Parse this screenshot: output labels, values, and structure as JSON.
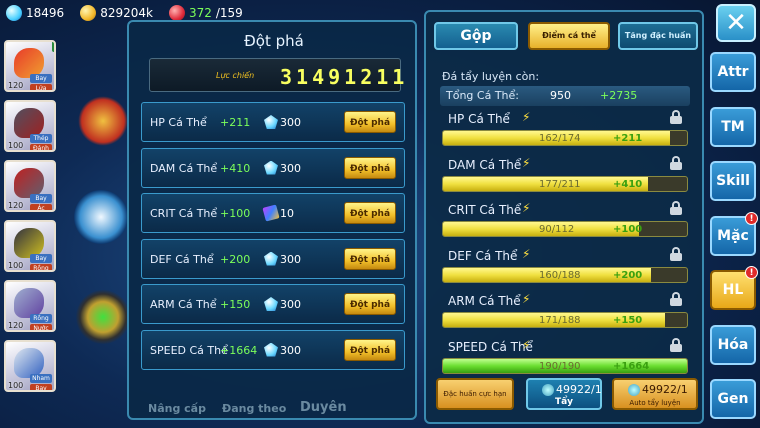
{
  "topbar": {
    "gems": "18496",
    "gold": "829204k",
    "stamina_current": "372",
    "stamina_max": "/159"
  },
  "pets": [
    {
      "level": "120",
      "tag1": "Bay",
      "tag2": "Lửa",
      "count": "1",
      "c1": "#e83a2a",
      "c2": "#f0a030"
    },
    {
      "level": "100",
      "tag1": "Thép",
      "tag2": "Đánh",
      "count": "",
      "c1": "#505060",
      "c2": "#a02020"
    },
    {
      "level": "120",
      "tag1": "Bay",
      "tag2": "Ác",
      "count": "",
      "c1": "#c02020",
      "c2": "#606070"
    },
    {
      "level": "100",
      "tag1": "Bay",
      "tag2": "Rồng",
      "count": "",
      "c1": "#303040",
      "c2": "#d0c020"
    },
    {
      "level": "120",
      "tag1": "Rồng",
      "tag2": "Nước",
      "count": "",
      "c1": "#a0b0d0",
      "c2": "#6040a0"
    },
    {
      "level": "100",
      "tag1": "Nham",
      "tag2": "Bay",
      "count": "",
      "c1": "#e0e8f0",
      "c2": "#3060c0"
    }
  ],
  "left_panel": {
    "title": "Đột phá",
    "power_label": "Lực chiến",
    "power_value": "31491211",
    "rows": [
      {
        "stat": "HP Cá Thể",
        "bonus": "+211",
        "cost_icon": "gem-icon",
        "cost": "300",
        "button": "Đột phá"
      },
      {
        "stat": "DAM Cá Thể",
        "bonus": "+410",
        "cost_icon": "gem-icon",
        "cost": "300",
        "button": "Đột phá"
      },
      {
        "stat": "CRIT Cá Thể",
        "bonus": "+100",
        "cost_icon": "scroll-icon",
        "cost": "10",
        "button": "Đột phá"
      },
      {
        "stat": "DEF Cá Thể",
        "bonus": "+200",
        "cost_icon": "gem-icon",
        "cost": "300",
        "button": "Đột phá"
      },
      {
        "stat": "ARM Cá Thể",
        "bonus": "+150",
        "cost_icon": "gem-icon",
        "cost": "300",
        "button": "Đột phá"
      },
      {
        "stat": "SPEED Cá Thể",
        "bonus": "+1664",
        "cost_icon": "gem-icon",
        "cost": "300",
        "button": "Đột phá"
      }
    ],
    "faded_buttons": [
      "Nâng cấp",
      "Đang theo",
      "Duyên"
    ]
  },
  "right_panel": {
    "tabs": [
      "Gộp",
      "Điểm cá thể",
      "Tăng đặc huấn"
    ],
    "remaining_label": "Đá tẩy luyện còn:",
    "total_label": "Tổng Cá Thể:",
    "total_value": "950",
    "total_bonus": "+2735",
    "stats": [
      {
        "label": "HP Cá Thể",
        "value": "162/174",
        "bonus": "+211",
        "fraction": 0.931
      },
      {
        "label": "DAM Cá Thể",
        "value": "177/211",
        "bonus": "+410",
        "fraction": 0.839
      },
      {
        "label": "CRIT Cá Thể",
        "value": "90/112",
        "bonus": "+100",
        "fraction": 0.804
      },
      {
        "label": "DEF Cá Thể",
        "value": "160/188",
        "bonus": "+200",
        "fraction": 0.851
      },
      {
        "label": "ARM Cá Thể",
        "value": "171/188",
        "bonus": "+150",
        "fraction": 0.91
      },
      {
        "label": "SPEED Cá Thể",
        "value": "190/190",
        "bonus": "+1664",
        "fraction": 1.0
      }
    ],
    "bottom_buttons": {
      "special_training": "Đặc huấn cực hạn",
      "wash_count": "49922/1",
      "wash_label": "Tẩy",
      "auto_count": "49922/1",
      "auto_label": "Auto tẩy luyện"
    }
  },
  "side_buttons": [
    {
      "label": "Attr",
      "badge": ""
    },
    {
      "label": "TM",
      "badge": ""
    },
    {
      "label": "Skill",
      "badge": ""
    },
    {
      "label": "Mặc",
      "badge": "!"
    },
    {
      "label": "HL",
      "badge": "!"
    },
    {
      "label": "Hóa",
      "badge": ""
    },
    {
      "label": "Gen",
      "badge": ""
    }
  ],
  "close_label": "✕"
}
